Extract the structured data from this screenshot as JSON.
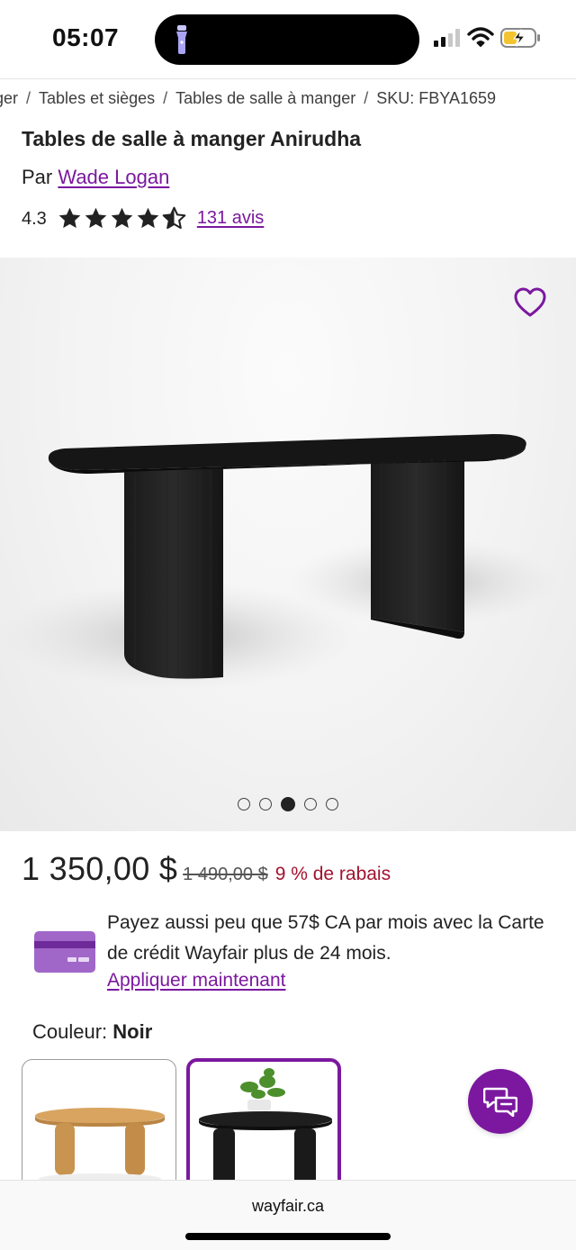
{
  "status_bar": {
    "time": "05:07"
  },
  "breadcrumb": {
    "items": [
      "ger",
      "Tables et sièges",
      "Tables de salle à manger"
    ],
    "sku": "SKU: FBYA1659",
    "separator": "/"
  },
  "product": {
    "title": "Tables de salle à manger Anirudha",
    "brand_prefix": "Par",
    "brand": "Wade Logan",
    "rating": "4.3",
    "rating_stars": 4.3,
    "reviews": "131 avis"
  },
  "gallery": {
    "image_count": 5,
    "active_index": 2,
    "favorite_icon": "heart-outline-icon"
  },
  "price": {
    "current": "1 350,00 $",
    "original": "1 490,00 $",
    "discount": "9 % de rabais"
  },
  "financing": {
    "text": "Payez aussi peu que 57$ CA par mois avec la Carte de crédit Wayfair plus de 24 mois.",
    "link": "Appliquer maintenant",
    "icon": "credit-card-icon"
  },
  "color": {
    "label": "Couleur:",
    "selected": "Noir",
    "options": [
      "oak-table-swatch",
      "black-table-swatch"
    ]
  },
  "chat": {
    "icon": "chat-bubbles-icon"
  },
  "browser": {
    "url": "wayfair.ca"
  },
  "colors": {
    "accent": "#7b189f",
    "discount": "#a3122e",
    "text": "#222222"
  }
}
